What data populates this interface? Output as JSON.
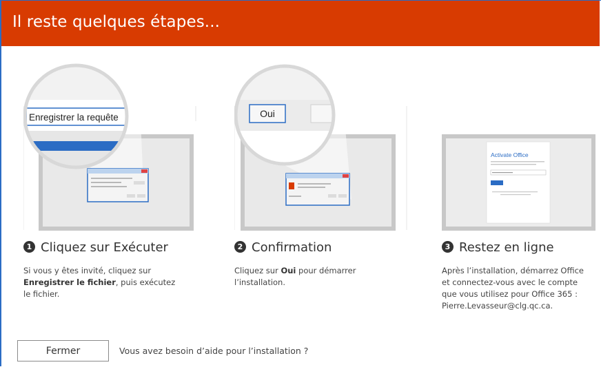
{
  "header": {
    "title": "Il reste quelques étapes..."
  },
  "steps": [
    {
      "number": "1",
      "title": "Cliquez sur Exécuter",
      "desc_before": "Si vous y êtes invité, cliquez sur ",
      "desc_bold": "Enregistrer le fichier",
      "desc_after": ", puis exécutez le fichier.",
      "callout_label": "Enregistrer la requête"
    },
    {
      "number": "2",
      "title": "Confirmation",
      "desc_before": "Cliquez sur ",
      "desc_bold": "Oui",
      "desc_after": " pour démarrer l’installation.",
      "callout_label": "Oui"
    },
    {
      "number": "3",
      "title": "Restez en ligne",
      "desc_before": "Après l’installation, démarrez Office et connectez-vous avec le compte que vous utilisez pour Office 365 : Pierre.Levasseur@clg.qc.ca.",
      "desc_bold": "",
      "desc_after": "",
      "dialog_title": "Activate Office"
    }
  ],
  "footer": {
    "close_label": "Fermer",
    "help_text": "Vous avez besoin d’aide pour l’installation ?"
  },
  "colors": {
    "header_bg": "#d83b01",
    "frame_border": "#2b6cc4",
    "accent_blue": "#2b6cc4"
  }
}
